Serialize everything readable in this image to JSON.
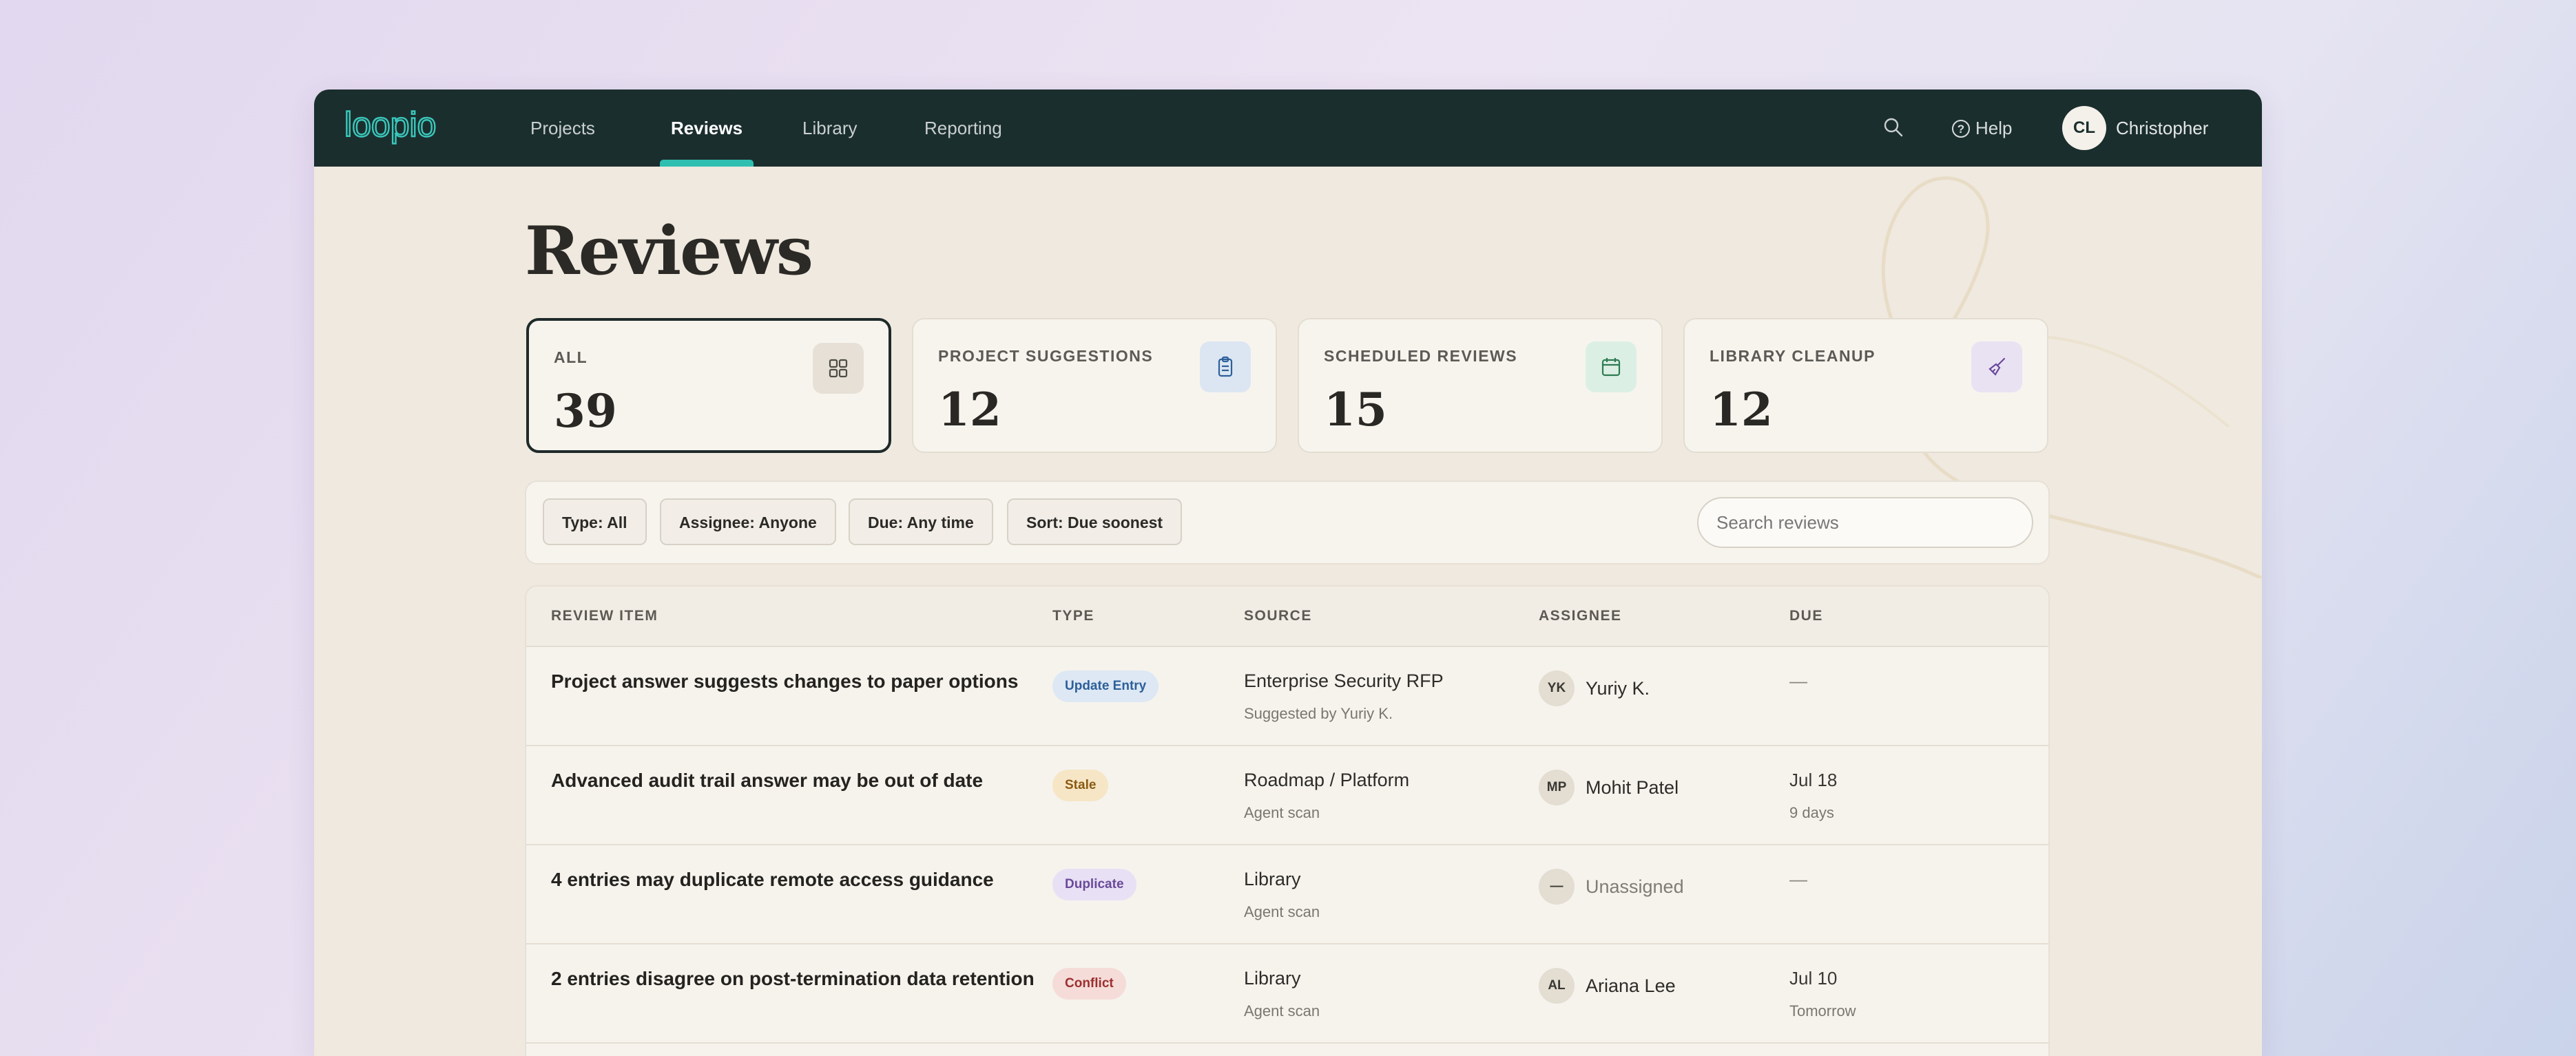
{
  "nav": {
    "logo": "loopio",
    "items": [
      {
        "label": "Projects",
        "active": false
      },
      {
        "label": "Reviews",
        "active": true
      },
      {
        "label": "Library",
        "active": false
      },
      {
        "label": "Reporting",
        "active": false
      }
    ],
    "help_label": "Help",
    "user_initials": "CL",
    "user_name": "Christopher",
    "accent": "#2fbfb1"
  },
  "page": {
    "title": "Reviews"
  },
  "stats": [
    {
      "label": "ALL",
      "value": "39",
      "icon": "grid-icon",
      "selected": true
    },
    {
      "label": "PROJECT SUGGESTIONS",
      "value": "12",
      "icon": "clipboard-icon",
      "selected": false
    },
    {
      "label": "SCHEDULED REVIEWS",
      "value": "15",
      "icon": "calendar-icon",
      "selected": false
    },
    {
      "label": "LIBRARY CLEANUP",
      "value": "12",
      "icon": "broom-icon",
      "selected": false
    }
  ],
  "filters": {
    "chips": [
      "Type: All",
      "Assignee: Anyone",
      "Due: Any time",
      "Sort: Due soonest"
    ],
    "search_placeholder": "Search reviews"
  },
  "table": {
    "headers": [
      "REVIEW ITEM",
      "TYPE",
      "SOURCE",
      "ASSIGNEE",
      "DUE"
    ],
    "rows": [
      {
        "title": "Project answer suggests changes to paper options",
        "type": "Update Entry",
        "type_color": "#2d5f9a",
        "type_bg": "#dde8f4",
        "source": "Enterprise Security RFP",
        "source_sub": "Suggested by Yuriy K.",
        "assignee_initials": "YK",
        "assignee": "Yuriy K.",
        "due": "—",
        "due_sub": ""
      },
      {
        "title": "Advanced audit trail answer may be out of date",
        "type": "Stale",
        "type_color": "#8a5a12",
        "type_bg": "#f6e6c6",
        "source": "Roadmap / Platform",
        "source_sub": "Agent scan",
        "assignee_initials": "MP",
        "assignee": "Mohit Patel",
        "due": "Jul 18",
        "due_sub": "9 days"
      },
      {
        "title": "4 entries may duplicate remote access guidance",
        "type": "Duplicate",
        "type_color": "#6a4a9a",
        "type_bg": "#e8e0f4",
        "source": "Library",
        "source_sub": "Agent scan",
        "assignee_initials": "—",
        "assignee": "Unassigned",
        "due": "—",
        "due_sub": ""
      },
      {
        "title": "2 entries disagree on post-termination data retention",
        "type": "Conflict",
        "type_color": "#9a2f2f",
        "type_bg": "#f5dcd8",
        "source": "Library",
        "source_sub": "Agent scan",
        "assignee_initials": "AL",
        "assignee": "Ariana Lee",
        "due": "Jul 10",
        "due_sub": "Tomorrow"
      }
    ]
  }
}
